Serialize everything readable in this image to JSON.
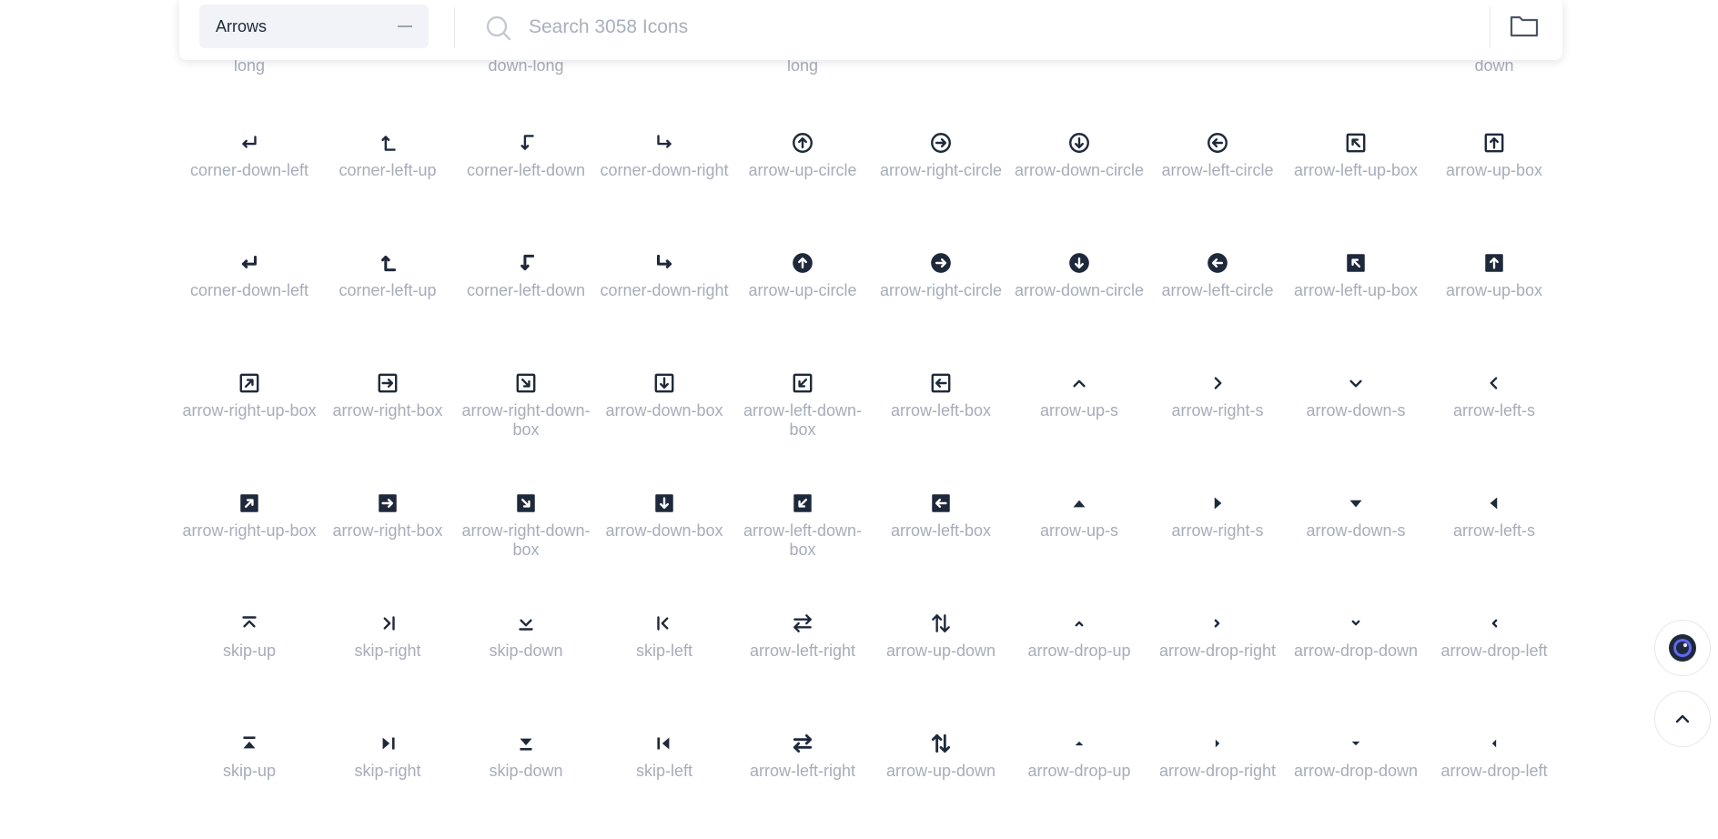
{
  "topbar": {
    "category": "Arrows",
    "search_placeholder": "Search 3058 Icons"
  },
  "partial_row": [
    {
      "col": 0,
      "label": "long"
    },
    {
      "col": 2,
      "label": "down-long"
    },
    {
      "col": 4,
      "label": "long"
    },
    {
      "col": 9,
      "label": "down"
    }
  ],
  "rows": [
    [
      "corner-down-left",
      "corner-left-up",
      "corner-left-down",
      "corner-down-right",
      "arrow-up-circle",
      "arrow-right-circle",
      "arrow-down-circle",
      "arrow-left-circle",
      "arrow-left-up-box",
      "arrow-up-box"
    ],
    [
      "corner-down-left",
      "corner-left-up",
      "corner-left-down",
      "corner-down-right",
      "arrow-up-circle",
      "arrow-right-circle",
      "arrow-down-circle",
      "arrow-left-circle",
      "arrow-left-up-box",
      "arrow-up-box"
    ],
    [
      "arrow-right-up-box",
      "arrow-right-box",
      "arrow-right-down-box",
      "arrow-down-box",
      "arrow-left-down-box",
      "arrow-left-box",
      "arrow-up-s",
      "arrow-right-s",
      "arrow-down-s",
      "arrow-left-s"
    ],
    [
      "arrow-right-up-box",
      "arrow-right-box",
      "arrow-right-down-box",
      "arrow-down-box",
      "arrow-left-down-box",
      "arrow-left-box",
      "arrow-up-s",
      "arrow-right-s",
      "arrow-down-s",
      "arrow-left-s"
    ],
    [
      "skip-up",
      "skip-right",
      "skip-down",
      "skip-left",
      "arrow-left-right",
      "arrow-up-down",
      "arrow-drop-up",
      "arrow-drop-right",
      "arrow-drop-down",
      "arrow-drop-left"
    ],
    [
      "skip-up",
      "skip-right",
      "skip-down",
      "skip-left",
      "arrow-left-right",
      "arrow-up-down",
      "arrow-drop-up",
      "arrow-drop-right",
      "arrow-drop-down",
      "arrow-drop-left"
    ]
  ],
  "colors": {
    "icon": "#1e293b",
    "label": "#a6adb9",
    "accent": "#4f46e5"
  }
}
